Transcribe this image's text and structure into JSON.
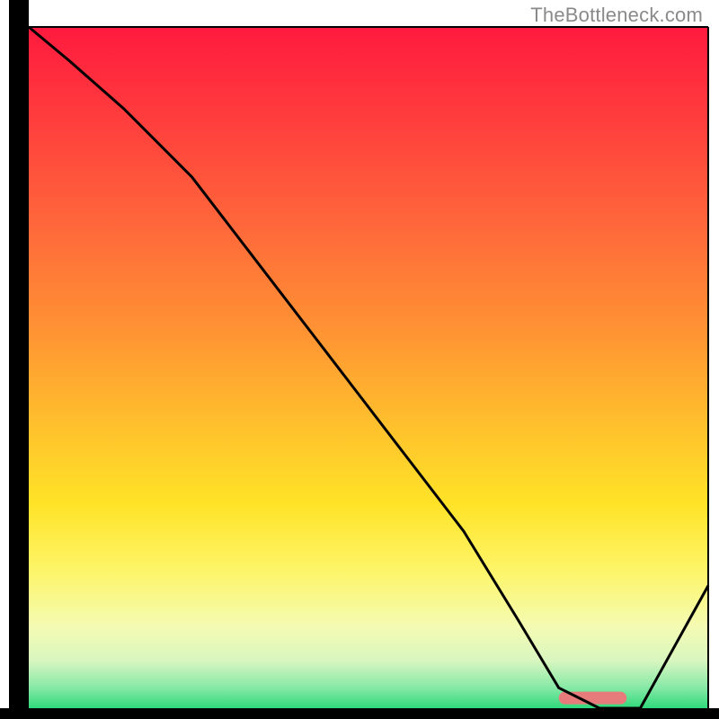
{
  "watermark": "TheBottleneck.com",
  "chart_data": {
    "type": "line",
    "title": "",
    "xlabel": "",
    "ylabel": "",
    "xlim": [
      0,
      100
    ],
    "ylim": [
      0,
      100
    ],
    "x": [
      0,
      6,
      14,
      24,
      34,
      44,
      54,
      64,
      72,
      78,
      84,
      90,
      100
    ],
    "values": [
      100,
      95,
      88,
      78,
      65,
      52,
      39,
      26,
      13,
      3,
      0,
      0,
      18
    ],
    "marker": {
      "x_start": 78,
      "x_end": 88,
      "y": 1.5,
      "color": "#e77b7b"
    },
    "gradient_stops": [
      {
        "offset": 0.0,
        "color": "#ff1a3e"
      },
      {
        "offset": 0.15,
        "color": "#ff413d"
      },
      {
        "offset": 0.3,
        "color": "#ff6a3a"
      },
      {
        "offset": 0.45,
        "color": "#ff9433"
      },
      {
        "offset": 0.58,
        "color": "#ffbf2d"
      },
      {
        "offset": 0.7,
        "color": "#ffe327"
      },
      {
        "offset": 0.8,
        "color": "#fdf56a"
      },
      {
        "offset": 0.88,
        "color": "#f4fbb2"
      },
      {
        "offset": 0.93,
        "color": "#d9f6c0"
      },
      {
        "offset": 0.97,
        "color": "#86e9a6"
      },
      {
        "offset": 1.0,
        "color": "#2fd97a"
      }
    ],
    "annotations": []
  }
}
